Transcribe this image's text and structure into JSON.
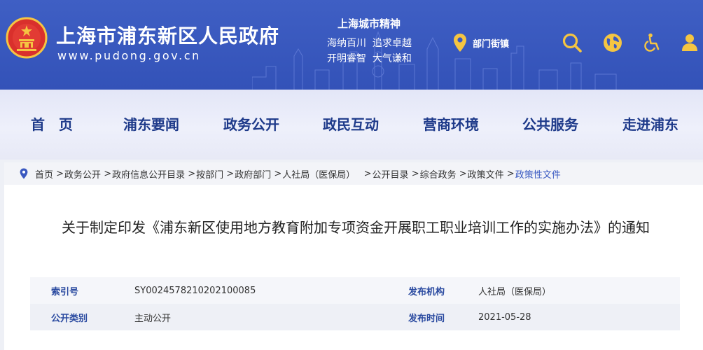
{
  "header": {
    "site_title": "上海市浦东新区人民政府",
    "site_url": "www.pudong.gov.cn",
    "spirit_title": "上海城市精神",
    "spirit_line1": "海纳百川  追求卓越",
    "spirit_line2": "开明睿智  大气谦和",
    "dept_link": "部门街镇",
    "icons": [
      "search-icon",
      "globe-icon",
      "accessibility-icon",
      "user-icon"
    ],
    "icon_color": "#f5c542",
    "background_color": "#3a58c0"
  },
  "nav": {
    "items": [
      "首　页",
      "浦东要闻",
      "政务公开",
      "政民互动",
      "营商环境",
      "公共服务",
      "走进浦东"
    ],
    "text_color": "#1e3a8a"
  },
  "breadcrumb": {
    "items": [
      "首页",
      "政务公开",
      "政府信息公开目录",
      "按部门",
      "政府部门",
      "人社局（医保局）",
      "公开目录",
      "综合政务",
      "政策文件",
      "政策性文件"
    ]
  },
  "document": {
    "title": "关于制定印发《浦东新区使用地方教育附加专项资金开展职工职业培训工作的实施办法》的通知",
    "meta": {
      "index_label": "索引号",
      "index_value": "SY0024578210202100085",
      "publisher_label": "发布机构",
      "publisher_value": "人社局（医保局）",
      "category_label": "公开类别",
      "category_value": "主动公开",
      "date_label": "发布时间",
      "date_value": "2021-05-28"
    }
  }
}
